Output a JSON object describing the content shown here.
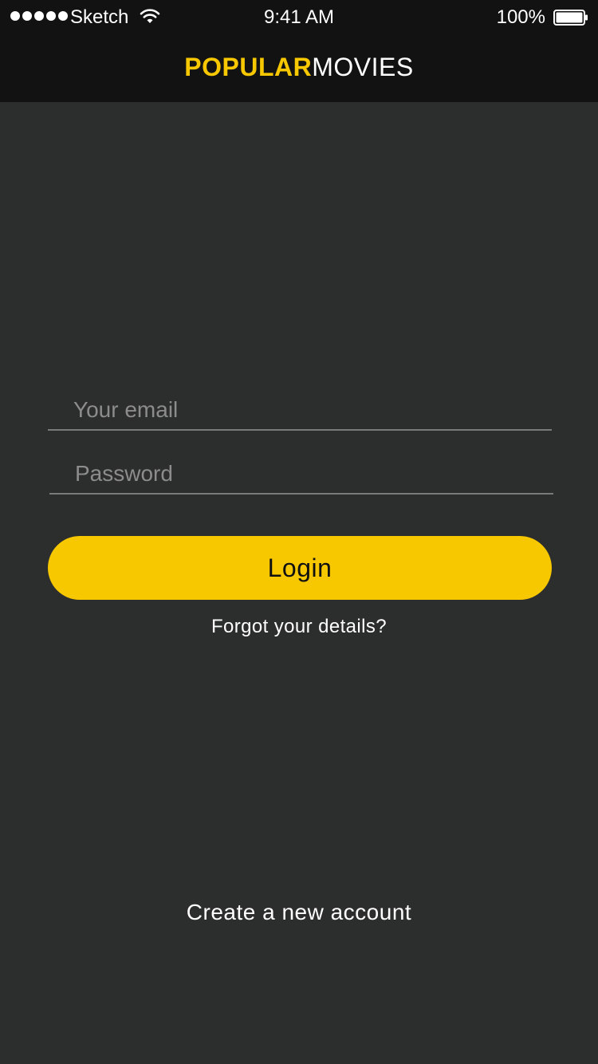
{
  "status_bar": {
    "carrier": "Sketch",
    "time": "9:41 AM",
    "battery_percent": "100%",
    "signal_icon": "signal-dots-icon",
    "wifi_icon": "wifi-icon",
    "battery_icon": "battery-icon"
  },
  "header": {
    "brand_part1": "POPULAR",
    "brand_part2": "MOVIES"
  },
  "login_form": {
    "email_placeholder": "Your email",
    "email_value": "",
    "password_placeholder": "Password",
    "password_value": "",
    "login_label": "Login",
    "forgot_label": "Forgot your details?"
  },
  "footer": {
    "create_account_label": "Create a new account"
  },
  "colors": {
    "accent": "#f7c800",
    "background": "#2c2d2d",
    "header_background": "#121212",
    "text": "#ffffff",
    "placeholder": "#8c8c8c",
    "field_underline": "#7a7a7a"
  }
}
